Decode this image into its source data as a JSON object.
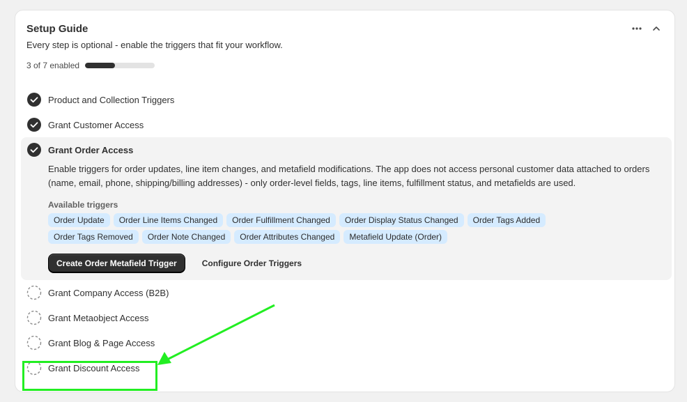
{
  "guide": {
    "title": "Setup Guide",
    "subtitle": "Every step is optional - enable the triggers that fit your workflow.",
    "progress_text": "3 of 7 enabled",
    "progress_value": 0.43,
    "icons": {
      "more": "more-horizontal-icon",
      "collapse": "chevron-up-icon"
    }
  },
  "steps": [
    {
      "label": "Product and Collection Triggers",
      "status": "done"
    },
    {
      "label": "Grant Customer Access",
      "status": "done"
    },
    {
      "label": "Grant Order Access",
      "status": "done",
      "description": "Enable triggers for order updates, line item changes, and metafield modifications. The app does not access personal customer data attached to orders (name, email, phone, shipping/billing addresses) - only order-level fields, tags, line items, fulfillment status, and metafields are used.",
      "triggers_title": "Available triggers",
      "triggers": [
        "Order Update",
        "Order Line Items Changed",
        "Order Fulfillment Changed",
        "Order Display Status Changed",
        "Order Tags Added",
        "Order Tags Removed",
        "Order Note Changed",
        "Order Attributes Changed",
        "Metafield Update (Order)"
      ],
      "primary_button": "Create Order Metafield Trigger",
      "secondary_button": "Configure Order Triggers"
    },
    {
      "label": "Grant Company Access (B2B)",
      "status": "pending"
    },
    {
      "label": "Grant Metaobject Access",
      "status": "pending"
    },
    {
      "label": "Grant Blog & Page Access",
      "status": "pending"
    },
    {
      "label": "Grant Discount Access",
      "status": "pending"
    }
  ],
  "annotation": {
    "color": "#22ee22"
  }
}
